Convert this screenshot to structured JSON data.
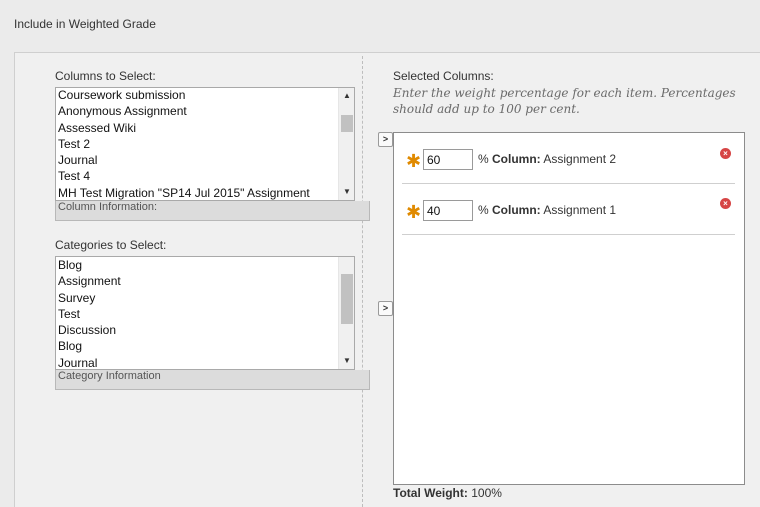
{
  "header": {
    "label": "Include in Weighted Grade"
  },
  "columns_section": {
    "label": "Columns to Select:",
    "items": [
      "Coursework submission",
      "Anonymous Assignment",
      "Assessed Wiki",
      "Test 2",
      "Journal",
      "Test 4",
      "MH Test Migration \"SP14 Jul 2015\" Assignment"
    ],
    "info_label": "Column Information:"
  },
  "categories_section": {
    "label": "Categories to Select:",
    "items": [
      "Blog",
      "Assignment",
      "Survey",
      "Test",
      "Discussion",
      "Blog",
      "Journal"
    ],
    "info_label": "Category Information"
  },
  "move_button_glyph": ">",
  "selected_section": {
    "label": "Selected Columns:",
    "instructions": "Enter the weight percentage for each item. Percentages should add up to 100 per cent.",
    "rows": [
      {
        "weight": "60",
        "prefix": "% ",
        "col_label": "Column:",
        "col_name": " Assignment 2"
      },
      {
        "weight": "40",
        "prefix": "% ",
        "col_label": "Column:",
        "col_name": " Assignment 1"
      }
    ]
  },
  "total": {
    "label": "Total Weight:",
    "value": " 100%"
  },
  "colors": {
    "required_star": "#e08a00",
    "remove": "#d64545"
  },
  "icons": {
    "required": "asterisk-icon",
    "remove": "remove-icon",
    "move": "chevron-right-icon"
  }
}
